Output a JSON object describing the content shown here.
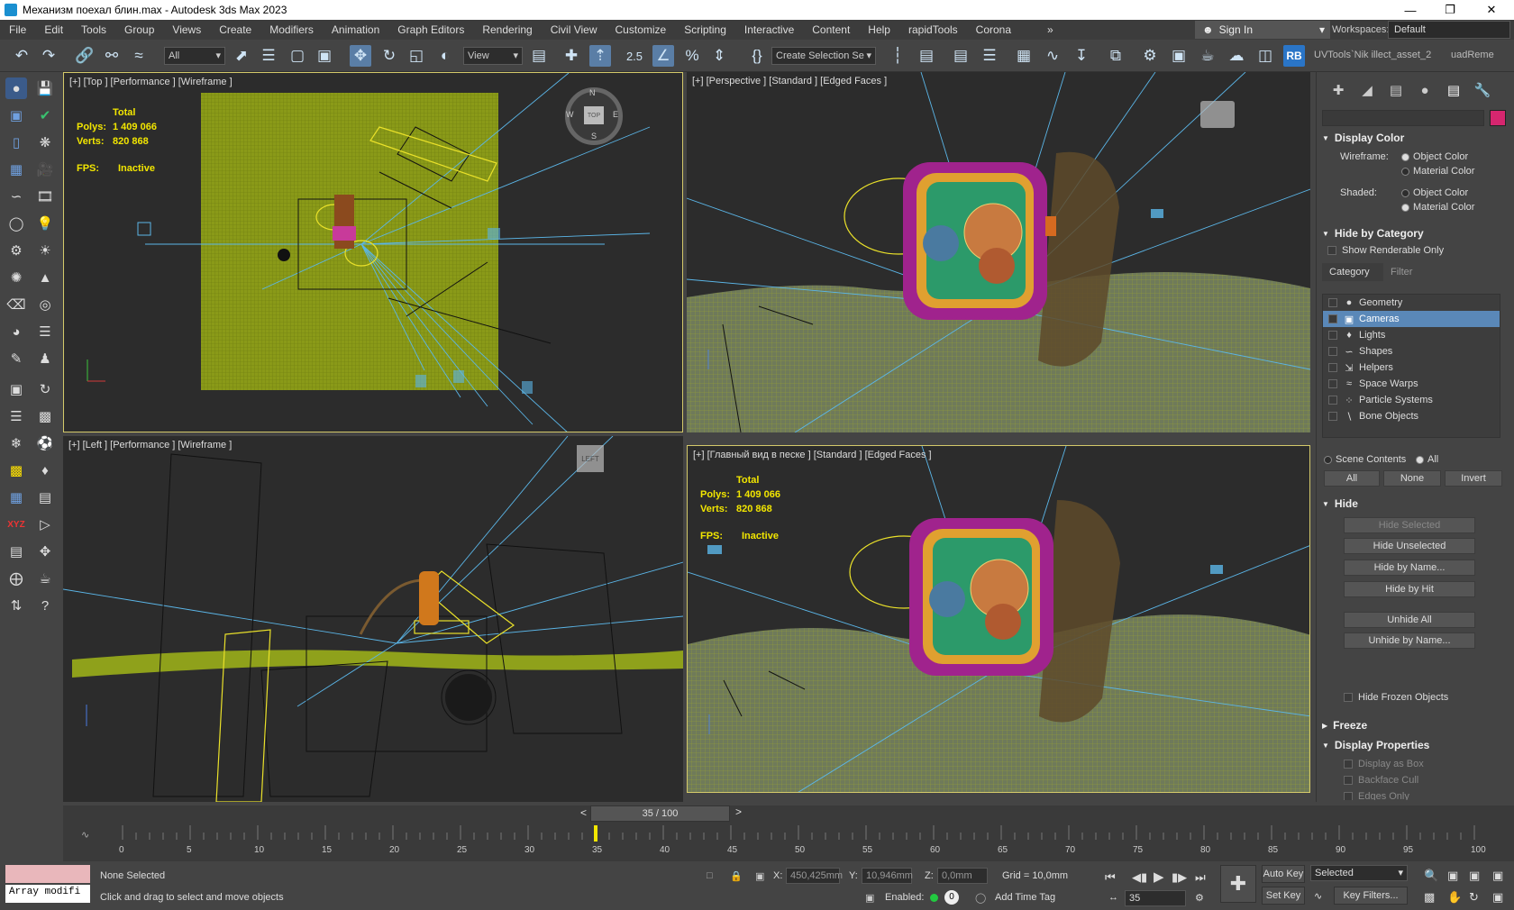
{
  "titlebar": {
    "title": "Механизм поехал блин.max - Autodesk 3ds Max 2023"
  },
  "menu": {
    "items": [
      "File",
      "Edit",
      "Tools",
      "Group",
      "Views",
      "Create",
      "Modifiers",
      "Animation",
      "Graph Editors",
      "Rendering",
      "Civil View",
      "Customize",
      "Scripting",
      "Interactive",
      "Content",
      "Help",
      "rapidTools",
      "Corona"
    ],
    "sign_in": "Sign In",
    "workspaces_label": "Workspaces:",
    "workspace": "Default"
  },
  "toolbar": {
    "selection_filter": "All",
    "ref_coord": "View",
    "selection_set": "Create Selection Se",
    "snap_label": "2.5",
    "uvtools_text": "UVTools`Nik  illect_asset_2",
    "uvtools_text2": "uadReme",
    "rb_label": "RB"
  },
  "viewports": {
    "top": {
      "label": "[+] [Top ] [Performance ] [Wireframe ]",
      "cube": "TOP",
      "compass": {
        "n": "N",
        "s": "S",
        "e": "E",
        "w": "W"
      }
    },
    "perspective": {
      "label": "[+] [Perspective ] [Standard ] [Edged Faces ]"
    },
    "left": {
      "label": "[+] [Left ] [Performance ] [Wireframe ]",
      "cube": "LEFT"
    },
    "camera": {
      "label": "[+] [Главный вид в песке ] [Standard ] [Edged Faces ]"
    }
  },
  "stats": {
    "total": "Total",
    "polys_label": "Polys:",
    "polys": "1 409 066",
    "verts_label": "Verts:",
    "verts": "820 868",
    "fps_label": "FPS:",
    "fps": "Inactive"
  },
  "command_panel": {
    "display_color": {
      "title": "Display Color",
      "wireframe_label": "Wireframe:",
      "shaded_label": "Shaded:",
      "object_color": "Object Color",
      "material_color": "Material Color"
    },
    "hide_by_category": {
      "title": "Hide by Category",
      "show_renderable": "Show Renderable Only",
      "tab_category": "Category",
      "tab_filter": "Filter",
      "items": [
        "Geometry",
        "Cameras",
        "Lights",
        "Shapes",
        "Helpers",
        "Space Warps",
        "Particle Systems",
        "Bone Objects"
      ],
      "scene_contents": "Scene Contents",
      "all_radio": "All",
      "btn_all": "All",
      "btn_none": "None",
      "btn_invert": "Invert"
    },
    "hide": {
      "title": "Hide",
      "hide_selected": "Hide Selected",
      "hide_unselected": "Hide Unselected",
      "hide_by_name": "Hide by Name...",
      "hide_by_hit": "Hide by Hit",
      "unhide_all": "Unhide All",
      "unhide_by_name": "Unhide by Name...",
      "hide_frozen": "Hide Frozen Objects"
    },
    "freeze": {
      "title": "Freeze"
    },
    "display_properties": {
      "title": "Display Properties",
      "display_as_box": "Display as Box",
      "backface_cull": "Backface Cull",
      "edges_only": "Edges Only"
    }
  },
  "timeline": {
    "frame_display": "35 / 100",
    "current_frame": 35,
    "total_frames": 100,
    "ticks": [
      "0",
      "5",
      "10",
      "15",
      "20",
      "25",
      "30",
      "35",
      "40",
      "45",
      "50",
      "55",
      "60",
      "65",
      "70",
      "75",
      "80",
      "85",
      "90",
      "95",
      "100"
    ]
  },
  "status": {
    "selection": "None Selected",
    "prompt": "Click and drag to select and move objects",
    "maxscript": "Array modifi",
    "x_label": "X:",
    "x": "450,425mm",
    "y_label": "Y:",
    "y": "10,946mm",
    "z_label": "Z:",
    "z": "0,0mm",
    "grid": "Grid = 10,0mm",
    "enabled_label": "Enabled:",
    "enabled_value": "0",
    "add_time_tag": "Add Time Tag",
    "auto_key": "Auto Key",
    "set_key": "Set Key",
    "key_mode": "Selected",
    "key_filters": "Key Filters...",
    "frame": "35"
  }
}
